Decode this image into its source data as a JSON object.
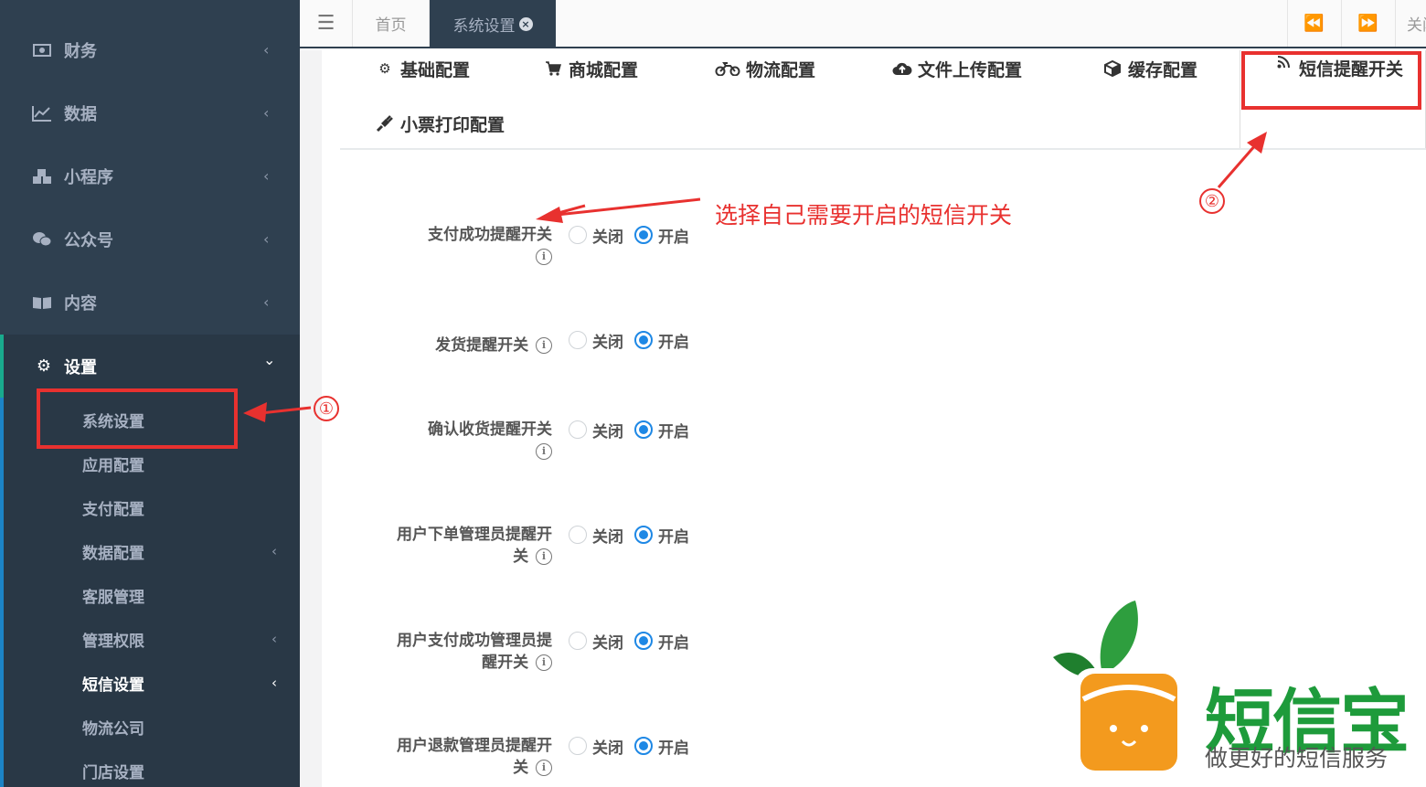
{
  "sidebar": {
    "items": [
      {
        "label": "财务",
        "icon": "money-icon"
      },
      {
        "label": "数据",
        "icon": "line-chart-icon"
      },
      {
        "label": "小程序",
        "icon": "cubes-icon"
      },
      {
        "label": "公众号",
        "icon": "wechat-icon"
      },
      {
        "label": "内容",
        "icon": "book-icon"
      },
      {
        "label": "设置",
        "icon": "gear-icon"
      }
    ],
    "arrow_collapsed": "‹",
    "arrow_expanded": "⌄",
    "sub_items": [
      {
        "label": "系统设置"
      },
      {
        "label": "应用配置"
      },
      {
        "label": "支付配置"
      },
      {
        "label": "数据配置"
      },
      {
        "label": "客服管理"
      },
      {
        "label": "管理权限"
      },
      {
        "label": "短信设置"
      },
      {
        "label": "物流公司"
      },
      {
        "label": "门店设置"
      }
    ]
  },
  "topbar": {
    "menu_icon": "☰",
    "tabs": [
      {
        "label": "首页"
      },
      {
        "label": "系统设置",
        "close": "×"
      }
    ],
    "prev_icon": "⏪",
    "next_icon": "⏩",
    "close_label": "关闭"
  },
  "config_tabs": [
    {
      "label": "基础配置",
      "icon": "gear-icon",
      "glyph": "⚙"
    },
    {
      "label": "商城配置",
      "icon": "cart-icon",
      "glyph": "🛒"
    },
    {
      "label": "物流配置",
      "icon": "motorcycle-icon",
      "glyph": "⛟"
    },
    {
      "label": "文件上传配置",
      "icon": "cloud-upload-icon",
      "glyph": "☁"
    },
    {
      "label": "缓存配置",
      "icon": "cube-icon",
      "glyph": "⬢"
    },
    {
      "label": "短信提醒开关",
      "icon": "rss-icon",
      "glyph": "◔"
    },
    {
      "label": "小票打印配置",
      "icon": "plug-icon",
      "glyph": "⚡"
    }
  ],
  "form": {
    "option_off": "关闭",
    "option_on": "开启",
    "info_glyph": "i",
    "rows": [
      {
        "label": "支付成功提醒开关",
        "selected": "开启"
      },
      {
        "label": "发货提醒开关",
        "selected": "开启"
      },
      {
        "label": "确认收货提醒开关",
        "selected": "开启"
      },
      {
        "label": "用户下单管理员提醒开关",
        "selected": "开启"
      },
      {
        "label": "用户支付成功管理员提醒开关",
        "selected": "开启"
      },
      {
        "label": "用户退款管理员提醒开关",
        "selected": "开启"
      }
    ]
  },
  "annotations": {
    "step1": "①",
    "step2": "②",
    "note": "选择自己需要开启的短信开关",
    "color": "#e8312f"
  },
  "logo": {
    "brand": "短信宝",
    "slogan": "做更好的短信服务",
    "brand_color": "#1e9b3b",
    "box_color": "#f39a1e"
  }
}
